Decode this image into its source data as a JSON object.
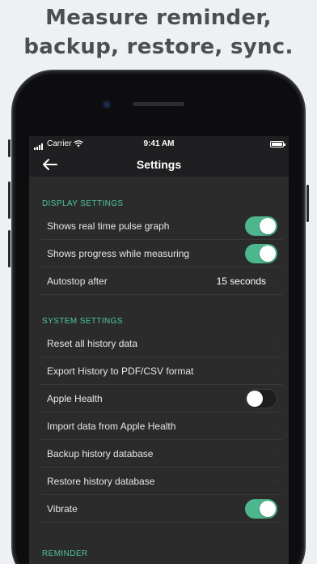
{
  "headline": {
    "line1": "Measure reminder,",
    "line2": "backup, restore, sync."
  },
  "status_bar": {
    "carrier": "Carrier",
    "time": "9:41 AM"
  },
  "nav": {
    "title": "Settings",
    "back_icon": "back-arrow-icon"
  },
  "sections": {
    "display": {
      "header": "DISPLAY SETTINGS",
      "pulse_graph": {
        "label": "Shows real time pulse graph",
        "on": true
      },
      "progress": {
        "label": "Shows progress while measuring",
        "on": true
      },
      "autostop": {
        "label": "Autostop after",
        "value": "15 seconds"
      }
    },
    "system": {
      "header": "SYSTEM SETTINGS",
      "reset": {
        "label": "Reset all history data"
      },
      "export": {
        "label": "Export History to PDF/CSV format"
      },
      "apple_health": {
        "label": "Apple Health",
        "on": false
      },
      "import": {
        "label": "Import data from Apple Health"
      },
      "backup": {
        "label": "Backup history database"
      },
      "restore": {
        "label": "Restore history database"
      },
      "vibrate": {
        "label": "Vibrate",
        "on": true
      }
    },
    "reminder": {
      "header": "REMINDER"
    }
  },
  "colors": {
    "accent": "#4fc6a0",
    "toggle_on": "#4cb68d",
    "screen_bg": "#2b2b2c",
    "bar_bg": "#1f1f21",
    "page_bg": "#eef1f3"
  }
}
